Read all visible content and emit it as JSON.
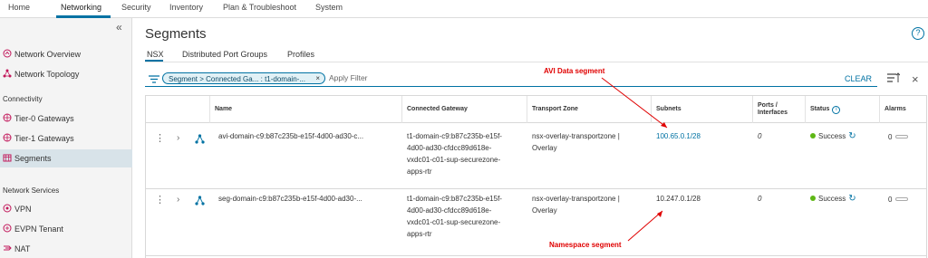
{
  "topnav": {
    "tabs": [
      {
        "label": "Home"
      },
      {
        "label": "Networking"
      },
      {
        "label": "Security"
      },
      {
        "label": "Inventory"
      },
      {
        "label": "Plan & Troubleshoot"
      },
      {
        "label": "System"
      }
    ],
    "active": "Networking"
  },
  "sidebar": {
    "collapse_glyph": "«",
    "items": [
      {
        "label": "Network Overview",
        "icon": "network-overview-icon"
      },
      {
        "label": "Network Topology",
        "icon": "network-topology-icon"
      },
      {
        "label": "Tier-0 Gateways",
        "icon": "tier0-gateway-icon"
      },
      {
        "label": "Tier-1 Gateways",
        "icon": "tier1-gateway-icon"
      },
      {
        "label": "Segments",
        "icon": "segments-icon",
        "active": true
      },
      {
        "label": "VPN",
        "icon": "vpn-icon"
      },
      {
        "label": "EVPN Tenant",
        "icon": "evpn-icon"
      },
      {
        "label": "NAT",
        "icon": "nat-icon"
      }
    ],
    "sections": {
      "connectivity": "Connectivity",
      "network_services": "Network Services"
    }
  },
  "page": {
    "title": "Segments",
    "help_glyph": "?",
    "subtabs": [
      {
        "label": "NSX"
      },
      {
        "label": "Distributed Port Groups"
      },
      {
        "label": "Profiles"
      }
    ],
    "active_subtab": "NSX"
  },
  "filter": {
    "chip_label": "Segment > Connected Ga... : ",
    "chip_value": "t1-domain-...",
    "chip_close": "×",
    "placeholder": "Apply Filter",
    "clear_label": "CLEAR",
    "close_glyph": "×"
  },
  "annotations": {
    "avi": "AVI Data segment",
    "namespace": "Namespace segment",
    "color": "#e00000"
  },
  "table": {
    "headers": {
      "name": "Name",
      "gateway": "Connected Gateway",
      "zone": "Transport Zone",
      "subnets": "Subnets",
      "ports_line1": "Ports /",
      "ports_line2": "Interfaces",
      "status": "Status",
      "alarms": "Alarms"
    },
    "rows": [
      {
        "name": "avi-domain-c9:b87c235b-e15f-4d00-ad30-c...",
        "gateway_lines": [
          "t1-domain-c9:b87c235b-e15f-",
          "4d00-ad30-cfdcc89d618e-",
          "vxdc01-c01-sup-securezone-",
          "apps-rtr"
        ],
        "zone_lines": [
          "nsx-overlay-transportzone |",
          "Overlay"
        ],
        "subnet": "100.65.0.1/28",
        "ports": "0",
        "status": "Success",
        "alarms": "0"
      },
      {
        "name": "seg-domain-c9:b87c235b-e15f-4d00-ad30-...",
        "gateway_lines": [
          "t1-domain-c9:b87c235b-e15f-",
          "4d00-ad30-cfdcc89d618e-",
          "vxdc01-c01-sup-securezone-",
          "apps-rtr"
        ],
        "zone_lines": [
          "nsx-overlay-transportzone |",
          "Overlay"
        ],
        "subnet": "10.247.0.1/28",
        "ports": "0",
        "status": "Success",
        "alarms": "0"
      }
    ]
  },
  "colors": {
    "accent": "#0072a3",
    "success": "#5eb715",
    "sidebar_bg": "#f4f4f4",
    "sidebar_active": "#d8e3e9"
  }
}
